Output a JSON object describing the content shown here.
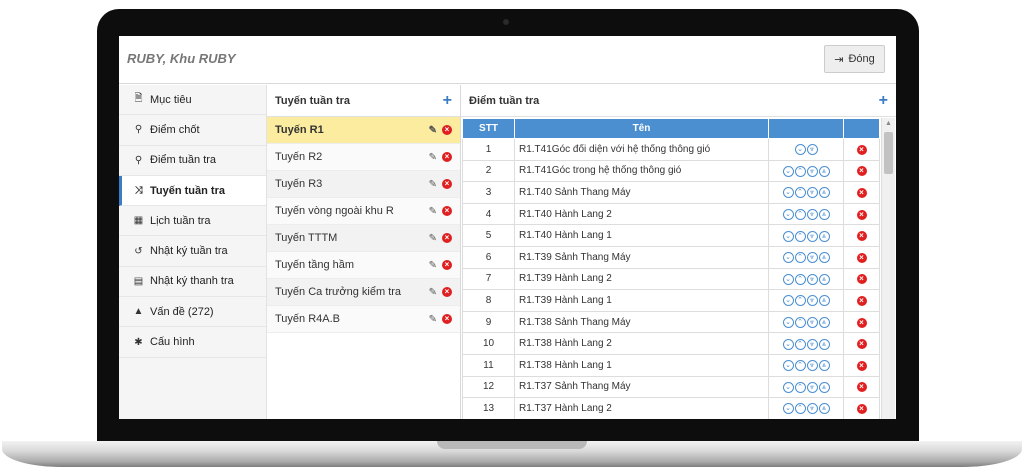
{
  "app_title": "RUBY, Khu RUBY",
  "close_button": {
    "icon": "sign-out-icon",
    "label": "Đóng"
  },
  "sidebar": {
    "items": [
      {
        "label": "Mục tiêu",
        "icon": "document-icon",
        "glyph": "🗎"
      },
      {
        "label": "Điểm chốt",
        "icon": "map-marker-icon",
        "glyph": "⚲"
      },
      {
        "label": "Điểm tuần tra",
        "icon": "map-marker-icon",
        "glyph": "⚲"
      },
      {
        "label": "Tuyến tuần tra",
        "icon": "random-icon",
        "glyph": "⤨",
        "active": true
      },
      {
        "label": "Lịch tuần tra",
        "icon": "calendar-icon",
        "glyph": "▦"
      },
      {
        "label": "Nhật ký tuần tra",
        "icon": "history-icon",
        "glyph": "↺"
      },
      {
        "label": "Nhật ký thanh tra",
        "icon": "list-alt-icon",
        "glyph": "▤"
      },
      {
        "label": "Vấn đề (272)",
        "icon": "warning-icon",
        "glyph": "▲"
      },
      {
        "label": "Cấu hình",
        "icon": "cog-icon",
        "glyph": "✱"
      }
    ]
  },
  "routes": {
    "title": "Tuyến tuần tra",
    "items": [
      {
        "label": "Tuyến R1",
        "active": true
      },
      {
        "label": "Tuyến R2"
      },
      {
        "label": "Tuyến R3"
      },
      {
        "label": "Tuyến vòng ngoài khu R"
      },
      {
        "label": "Tuyến TTTM"
      },
      {
        "label": "Tuyến tầng hầm"
      },
      {
        "label": "Tuyến Ca trưởng kiểm tra"
      },
      {
        "label": "Tuyến R4A.B"
      }
    ]
  },
  "points": {
    "title": "Điểm tuần tra",
    "columns": {
      "stt": "STT",
      "name": "Tên"
    },
    "rows": [
      {
        "stt": "1",
        "name": "R1.T41Góc đối diện với hệ thống thông gió",
        "arrows": [
          "down",
          "double-down"
        ]
      },
      {
        "stt": "2",
        "name": "R1.T41Góc trong hệ thống thông gió",
        "arrows": [
          "down",
          "up",
          "double-down",
          "double-up"
        ]
      },
      {
        "stt": "3",
        "name": "R1.T40 Sảnh Thang Máy",
        "arrows": [
          "down",
          "up",
          "double-down",
          "double-up"
        ]
      },
      {
        "stt": "4",
        "name": "R1.T40 Hành Lang 2",
        "arrows": [
          "down",
          "up",
          "double-down",
          "double-up"
        ]
      },
      {
        "stt": "5",
        "name": "R1.T40 Hành Lang 1",
        "arrows": [
          "down",
          "up",
          "double-down",
          "double-up"
        ]
      },
      {
        "stt": "6",
        "name": "R1.T39 Sảnh Thang Máy",
        "arrows": [
          "down",
          "up",
          "double-down",
          "double-up"
        ]
      },
      {
        "stt": "7",
        "name": "R1.T39 Hành Lang 2",
        "arrows": [
          "down",
          "up",
          "double-down",
          "double-up"
        ]
      },
      {
        "stt": "8",
        "name": "R1.T39 Hành Lang 1",
        "arrows": [
          "down",
          "up",
          "double-down",
          "double-up"
        ]
      },
      {
        "stt": "9",
        "name": "R1.T38 Sảnh Thang Máy",
        "arrows": [
          "down",
          "up",
          "double-down",
          "double-up"
        ]
      },
      {
        "stt": "10",
        "name": "R1.T38 Hành Lang 2",
        "arrows": [
          "down",
          "up",
          "double-down",
          "double-up"
        ]
      },
      {
        "stt": "11",
        "name": "R1.T38 Hành Lang 1",
        "arrows": [
          "down",
          "up",
          "double-down",
          "double-up"
        ]
      },
      {
        "stt": "12",
        "name": "R1.T37 Sảnh Thang Máy",
        "arrows": [
          "down",
          "up",
          "double-down",
          "double-up"
        ]
      },
      {
        "stt": "13",
        "name": "R1.T37 Hành Lang 2",
        "arrows": [
          "down",
          "up",
          "double-down",
          "double-up"
        ]
      }
    ]
  },
  "colors": {
    "accent": "#4b8fd1",
    "active_route": "#fbec9f",
    "delete": "#e02020"
  }
}
